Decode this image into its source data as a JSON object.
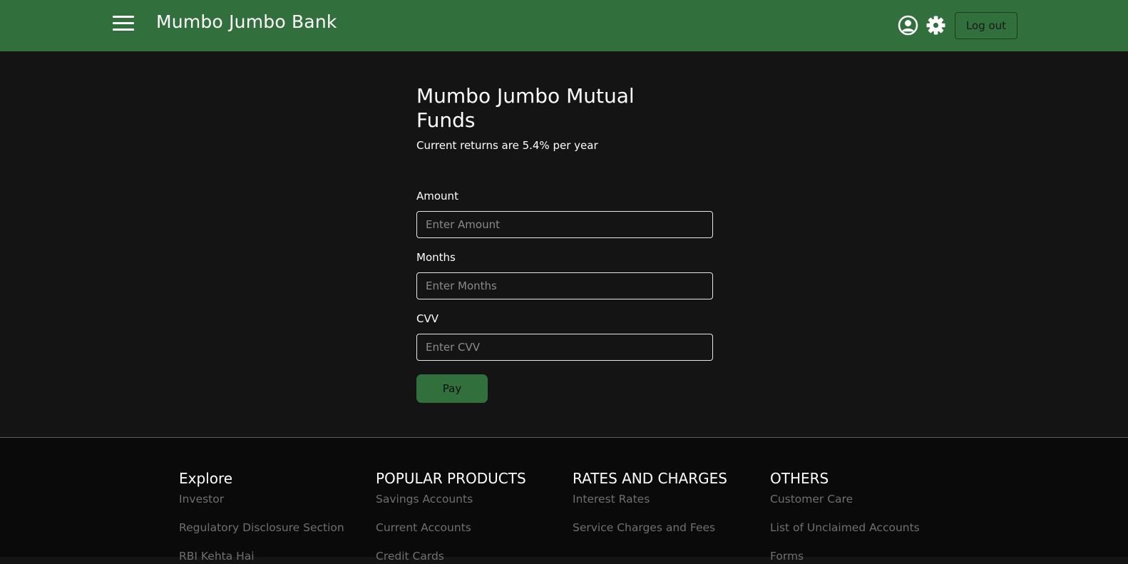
{
  "header": {
    "brand": "Mumbo Jumbo Bank",
    "logout_label": "Log out"
  },
  "main": {
    "title": "Mumbo Jumbo Mutual Funds",
    "subtitle": "Current returns are 5.4% per year",
    "amount": {
      "label": "Amount",
      "placeholder": "Enter Amount",
      "value": ""
    },
    "months": {
      "label": "Months",
      "placeholder": "Enter Months",
      "value": ""
    },
    "cvv": {
      "label": "CVV",
      "placeholder": "Enter CVV",
      "value": ""
    },
    "pay_label": "Pay"
  },
  "footer": {
    "columns": [
      {
        "heading": "Explore",
        "links": [
          "Investor",
          "Regulatory Disclosure Section",
          "RBI Kehta Hai"
        ]
      },
      {
        "heading": "POPULAR PRODUCTS",
        "links": [
          "Savings Accounts",
          "Current Accounts",
          "Credit Cards"
        ]
      },
      {
        "heading": "RATES AND CHARGES",
        "links": [
          "Interest Rates",
          "Service Charges and Fees"
        ]
      },
      {
        "heading": "OTHERS",
        "links": [
          "Customer Care",
          "List of Unclaimed Accounts",
          "Forms"
        ]
      }
    ]
  },
  "colors": {
    "brand_green": "#31703c",
    "background": "#141414",
    "footer_background": "#0a0a0a",
    "footer_link": "#6f6f6f"
  },
  "icons": {
    "menu": "menu-icon",
    "user": "user-circle-icon",
    "settings": "gear-icon"
  }
}
